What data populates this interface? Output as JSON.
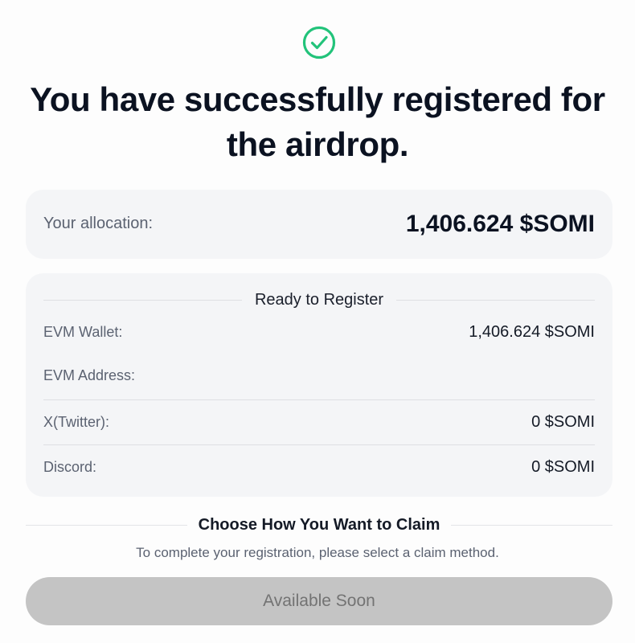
{
  "header": {
    "icon": "check-circle-icon",
    "accent_color": "#22c37a",
    "title": "You have successfully registered for the airdrop."
  },
  "allocation": {
    "label": "Your allocation:",
    "value": "1,406.624 $SOMI"
  },
  "details": {
    "heading": "Ready to Register",
    "rows": [
      {
        "label": "EVM Wallet:",
        "value": "1,406.624 $SOMI"
      },
      {
        "label": "EVM Address:",
        "value": ""
      },
      {
        "label": "X(Twitter):",
        "value": "0 $SOMI"
      },
      {
        "label": "Discord:",
        "value": "0 $SOMI"
      }
    ]
  },
  "claim": {
    "heading": "Choose How You Want to Claim",
    "subtitle": "To complete your registration, please select a claim method.",
    "button_label": "Available Soon",
    "button_color": "#c4c4c4"
  }
}
